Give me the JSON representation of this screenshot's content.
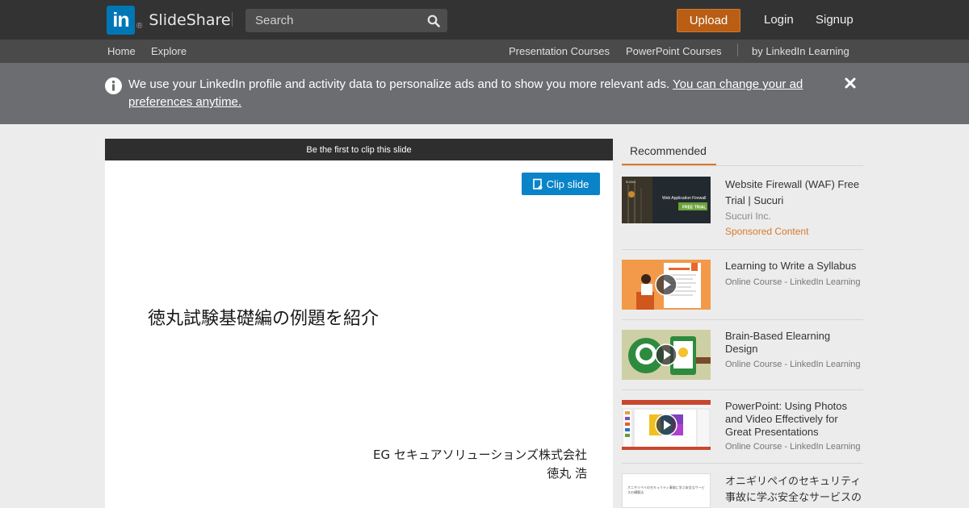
{
  "header": {
    "logo_text": "SlideShare",
    "logo_mark": "in",
    "search_placeholder": "Search",
    "upload_label": "Upload",
    "login_label": "Login",
    "signup_label": "Signup"
  },
  "subnav": {
    "home": "Home",
    "explore": "Explore",
    "presentation_courses": "Presentation Courses",
    "powerpoint_courses": "PowerPoint Courses",
    "by_linkedin": "by LinkedIn Learning"
  },
  "notice": {
    "text": "We use your LinkedIn profile and activity data to personalize ads and to show you more relevant ads. ",
    "link": "You can change your ad preferences anytime."
  },
  "slide": {
    "clip_bar_text": "Be the first to clip this slide",
    "clip_button": "Clip slide",
    "title": "徳丸試験基礎編の例題を紹介",
    "company": "EG セキュアソリューションズ株式会社",
    "author": "徳丸 浩"
  },
  "sidebar": {
    "tab_label": "Recommended",
    "items": [
      {
        "title": "Website Firewall (WAF) Free Trial | Sucuri",
        "subtitle": "Sucuri Inc.",
        "badge": "Sponsored Content",
        "thumb_text_1": "Web Application Firewall",
        "thumb_text_2": "FREE TRIAL",
        "thumb_brand": "sucuri"
      },
      {
        "title": "Learning to Write a Syllabus",
        "subtitle": "Online Course - LinkedIn Learning"
      },
      {
        "title": "Brain-Based Elearning Design",
        "subtitle": "Online Course - LinkedIn Learning"
      },
      {
        "title": "PowerPoint: Using Photos and Video Effectively for Great Presentations",
        "subtitle": "Online Course - LinkedIn Learning"
      },
      {
        "title": "オニギリペイのセキュリティ事故に学ぶ安全なサービスの",
        "thumb_text": "オニギリペイのセキュリティ事故に学ぶ安全なサービスの構築法"
      }
    ]
  },
  "colors": {
    "topbar": "#333333",
    "subnav": "#4a4a4a",
    "notice": "#6b6d70",
    "upload": "#b95e14",
    "clip_button": "#0a84c8",
    "accent": "#d9792b"
  }
}
